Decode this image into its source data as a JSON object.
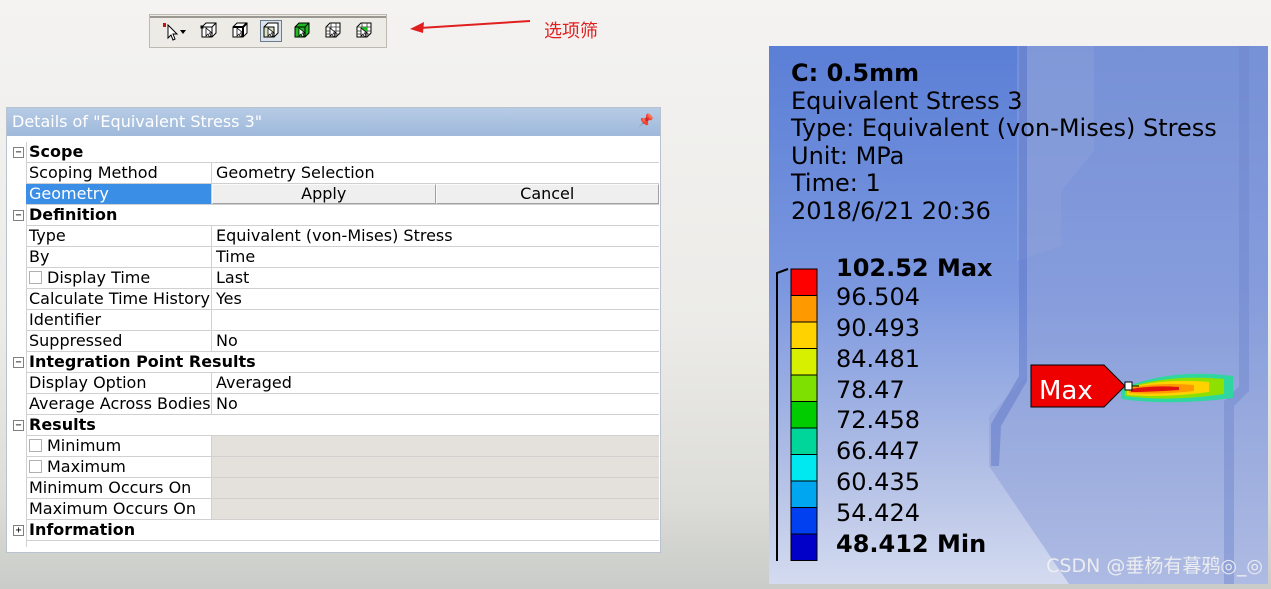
{
  "annotation": {
    "text": "选项筛",
    "color": "#e02020"
  },
  "toolbar": {
    "buttons": [
      {
        "icon": "pointer-mode-icon"
      },
      {
        "icon": "select-vertex-icon"
      },
      {
        "icon": "select-edge-icon"
      },
      {
        "icon": "select-face-icon"
      },
      {
        "icon": "select-body-icon"
      },
      {
        "icon": "select-node-icon"
      },
      {
        "icon": "select-element-icon"
      }
    ]
  },
  "details": {
    "title": "Details of \"Equivalent Stress 3\"",
    "pin": "ű",
    "scope": {
      "header": "Scope",
      "scoping_method": {
        "label": "Scoping Method",
        "value": "Geometry Selection"
      },
      "geometry": {
        "label": "Geometry",
        "apply": "Apply",
        "cancel": "Cancel"
      }
    },
    "definition": {
      "header": "Definition",
      "type": {
        "label": "Type",
        "value": "Equivalent (von-Mises) Stress"
      },
      "by": {
        "label": "By",
        "value": "Time"
      },
      "display_time": {
        "label": "Display Time",
        "value": "Last"
      },
      "calc_history": {
        "label": "Calculate Time History",
        "value": "Yes"
      },
      "identifier": {
        "label": "Identifier",
        "value": ""
      },
      "suppressed": {
        "label": "Suppressed",
        "value": "No"
      }
    },
    "integration": {
      "header": "Integration Point Results",
      "display_option": {
        "label": "Display Option",
        "value": "Averaged"
      },
      "average_across": {
        "label": "Average Across Bodies",
        "value": "No"
      }
    },
    "results": {
      "header": "Results",
      "minimum": {
        "label": "Minimum"
      },
      "maximum": {
        "label": "Maximum"
      },
      "min_occurs": {
        "label": "Minimum Occurs On"
      },
      "max_occurs": {
        "label": "Maximum Occurs On"
      }
    },
    "information": {
      "header": "Information"
    }
  },
  "result": {
    "info": {
      "name": "C: 0.5mm",
      "title": "Equivalent Stress 3",
      "type": "Type: Equivalent (von-Mises) Stress",
      "unit": "Unit: MPa",
      "time": "Time: 1",
      "date": "2018/6/21 20:36"
    },
    "legend": {
      "max_label": "102.52 Max",
      "min_label": "48.412 Min",
      "values": [
        "96.504",
        "90.493",
        "84.481",
        "78.47",
        "72.458",
        "66.447",
        "60.435",
        "54.424"
      ],
      "colors": [
        "#ff0000",
        "#ff9900",
        "#ffd200",
        "#d6f000",
        "#7ee000",
        "#00cc00",
        "#00d69a",
        "#00e8f0",
        "#00a6f0",
        "#0040f0",
        "#0000c8"
      ]
    },
    "max_probe": "Max",
    "watermark": "CSDN @垂杨有暮鸦◎_◎"
  }
}
